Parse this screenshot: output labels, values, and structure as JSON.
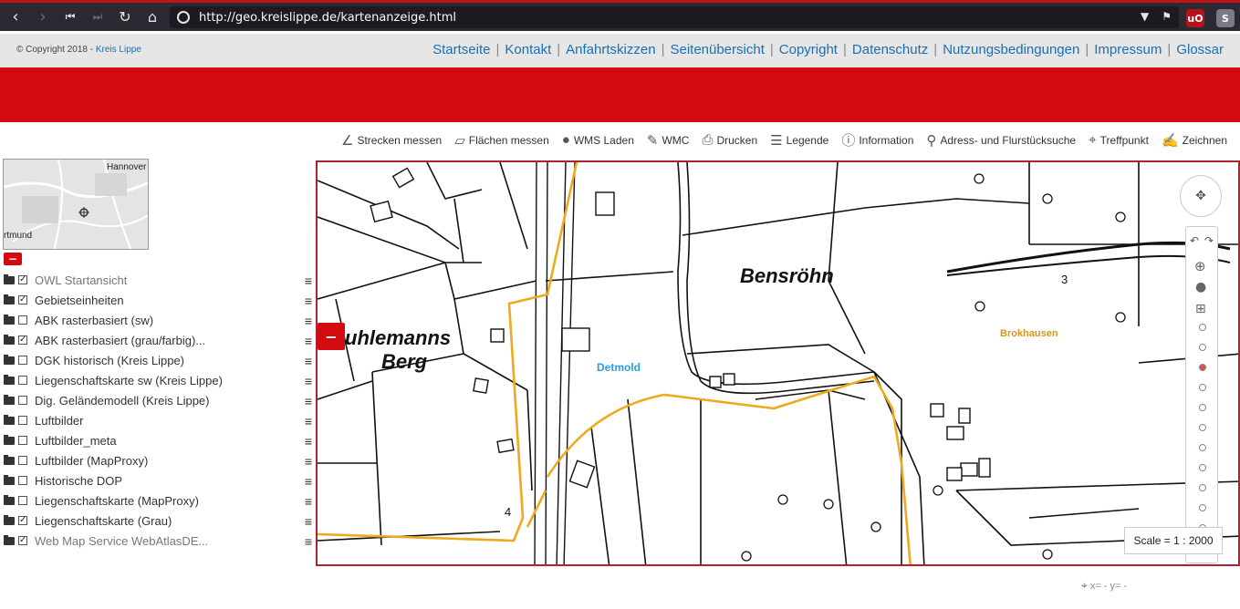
{
  "browser": {
    "url": "http://geo.kreislippe.de/kartenanzeige.html",
    "ext1": "uO",
    "ext2": "S"
  },
  "topbar": {
    "copyright_prefix": "© Copyright 2018 - ",
    "copyright_link": "Kreis Lippe",
    "links": [
      "Startseite",
      "Kontakt",
      "Anfahrtskizzen",
      "Seitenübersicht",
      "Copyright",
      "Datenschutz",
      "Nutzungsbedingungen",
      "Impressum",
      "Glossar"
    ]
  },
  "toolbar": [
    {
      "label": "Strecken messen",
      "icon": "ruler-icon"
    },
    {
      "label": "Flächen messen",
      "icon": "area-icon"
    },
    {
      "label": "WMS Laden",
      "icon": "globe-icon"
    },
    {
      "label": "WMC",
      "icon": "edit-icon"
    },
    {
      "label": "Drucken",
      "icon": "printer-icon"
    },
    {
      "label": "Legende",
      "icon": "list-icon"
    },
    {
      "label": "Information",
      "icon": "info-icon"
    },
    {
      "label": "Adress- und Flurstücksuche",
      "icon": "search-icon"
    },
    {
      "label": "Treffpunkt",
      "icon": "pin-icon"
    },
    {
      "label": "Zeichnen",
      "icon": "pencil-icon"
    }
  ],
  "overview": {
    "label_ne": "Hannover",
    "label_sw": "rtmund"
  },
  "collapse_label": "−",
  "layers": [
    {
      "label": "OWL Startansicht",
      "checked": true,
      "muted": true
    },
    {
      "label": "Gebietseinheiten",
      "checked": true,
      "muted": false
    },
    {
      "label": "ABK rasterbasiert (sw)",
      "checked": false,
      "muted": false
    },
    {
      "label": "ABK rasterbasiert (grau/farbig)...",
      "checked": true,
      "muted": false
    },
    {
      "label": "DGK historisch (Kreis Lippe)",
      "checked": false,
      "muted": false
    },
    {
      "label": "Liegenschaftskarte sw (Kreis Lippe)",
      "checked": false,
      "muted": false
    },
    {
      "label": "Dig. Geländemodell (Kreis Lippe)",
      "checked": false,
      "muted": false
    },
    {
      "label": "Luftbilder",
      "checked": false,
      "muted": false
    },
    {
      "label": "Luftbilder_meta",
      "checked": false,
      "muted": false
    },
    {
      "label": "Luftbilder (MapProxy)",
      "checked": false,
      "muted": false
    },
    {
      "label": "Historische DOP",
      "checked": false,
      "muted": false
    },
    {
      "label": "Liegenschaftskarte (MapProxy)",
      "checked": false,
      "muted": false
    },
    {
      "label": "Liegenschaftskarte (Grau)",
      "checked": true,
      "muted": false
    },
    {
      "label": "Web Map Service WebAtlasDE...",
      "checked": true,
      "muted": true
    }
  ],
  "map": {
    "label_bensroehn": "Bensröhn",
    "label_uhlemanns_1": "uhlemanns",
    "label_uhlemanns_2": "Berg",
    "label_detmold": "Detmold",
    "label_brokhausen": "Brokhausen",
    "label_3": "3",
    "label_4": "4",
    "scale": "Scale = 1 : 2000",
    "zoom_level_fraction": 0.22
  },
  "coords": "x= - y= -",
  "colors": {
    "brand_red": "#d30a10",
    "link_blue": "#1a6fb3",
    "route_orange": "#f0a81e",
    "detmold_blue": "#2a9ee0",
    "brokhausen_orange": "#d9961a"
  }
}
